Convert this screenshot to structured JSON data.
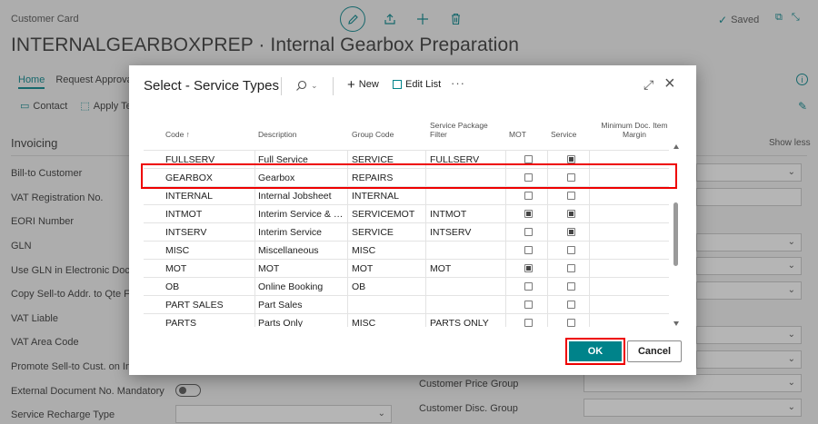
{
  "card": {
    "caption": "Customer Card",
    "title": "INTERNALGEARBOXPREP · Internal Gearbox Preparation",
    "saved_label": "Saved",
    "tabs": [
      "Home",
      "Request Approval"
    ],
    "actions": [
      "Contact",
      "Apply Te"
    ],
    "section_title": "Invoicing",
    "show_less": "Show less",
    "fields": [
      "Bill-to Customer",
      "VAT Registration No.",
      "EORI Number",
      "GLN",
      "Use GLN in Electronic Docume",
      "Copy Sell-to Addr. to Qte Fro",
      "VAT Liable",
      "VAT Area Code",
      "Promote Sell-to Cust. on Invo",
      "External Document No. Mandatory",
      "Service Recharge Type"
    ],
    "right_fields": [
      "Customer Price Group",
      "Customer Disc. Group"
    ]
  },
  "dialog": {
    "title": "Select - Service Types",
    "new_label": "New",
    "edit_list_label": "Edit List",
    "more_label": "···",
    "columns": {
      "code": "Code ↑",
      "description": "Description",
      "group_code": "Group Code",
      "pkg_filter_1": "Service Package",
      "pkg_filter_2": "Filter",
      "mot": "MOT",
      "service": "Service",
      "min_doc_1": "Minimum Doc. Item",
      "min_doc_2": "Margin"
    },
    "rows": [
      {
        "code": "FULLSERV",
        "description": "Full Service",
        "group": "SERVICE",
        "filter": "FULLSERV",
        "mot": false,
        "service": true
      },
      {
        "code": "GEARBOX",
        "description": "Gearbox",
        "group": "REPAIRS",
        "filter": "",
        "mot": false,
        "service": false
      },
      {
        "code": "INTERNAL",
        "description": "Internal Jobsheet",
        "group": "INTERNAL",
        "filter": "",
        "mot": false,
        "service": false
      },
      {
        "code": "INTMOT",
        "description": "Interim Service & MOT",
        "group": "SERVICEMOT",
        "filter": "INTMOT",
        "mot": true,
        "service": true
      },
      {
        "code": "INTSERV",
        "description": "Interim Service",
        "group": "SERVICE",
        "filter": "INTSERV",
        "mot": false,
        "service": true
      },
      {
        "code": "MISC",
        "description": "Miscellaneous",
        "group": "MISC",
        "filter": "",
        "mot": false,
        "service": false
      },
      {
        "code": "MOT",
        "description": "MOT",
        "group": "MOT",
        "filter": "MOT",
        "mot": true,
        "service": false
      },
      {
        "code": "OB",
        "description": "Online Booking",
        "group": "OB",
        "filter": "",
        "mot": false,
        "service": false
      },
      {
        "code": "PART SALES",
        "description": "Part Sales",
        "group": "",
        "filter": "",
        "mot": false,
        "service": false
      },
      {
        "code": "PARTS",
        "description": "Parts Only",
        "group": "MISC",
        "filter": "PARTS ONLY",
        "mot": false,
        "service": false
      }
    ],
    "ok_label": "OK",
    "cancel_label": "Cancel"
  },
  "colors": {
    "accent": "#00838a",
    "highlight": "#e00000"
  }
}
